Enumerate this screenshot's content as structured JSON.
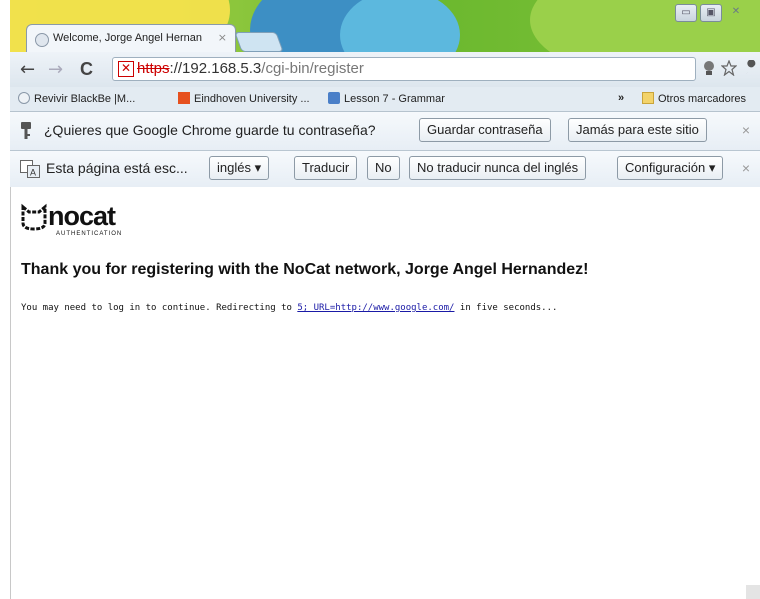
{
  "window": {
    "tab_title": "Welcome, Jorge Angel Hernan",
    "tab_close": "×",
    "minimize": "▭",
    "maximize": "▣",
    "close": "✕"
  },
  "toolbar": {
    "back": "←",
    "forward": "→",
    "reload": "C",
    "url_scheme": "https",
    "url_host": "://192.168.5.3",
    "url_path": "/cgi-bin/register",
    "ssl_error": "✕"
  },
  "bookmarks": {
    "items": [
      {
        "label": "Revivir BlackBe   |M...",
        "icon": "page-icon"
      },
      {
        "label": "Eindhoven University ...",
        "icon": "tue-icon"
      },
      {
        "label": "Lesson 7 - Grammar",
        "icon": "book-icon"
      }
    ],
    "overflow": "»",
    "other": "Otros marcadores"
  },
  "password_bar": {
    "text": "¿Quieres que Google Chrome guarde tu contraseña?",
    "save_label": "Guardar contraseña",
    "never_label": "Jamás para este sitio",
    "close": "×"
  },
  "translate_bar": {
    "text": "Esta página está esc...",
    "language": "inglés",
    "translate_label": "Traducir",
    "no_label": "No",
    "never_label": "No traducir nunca del inglés",
    "settings_label": "Configuración",
    "close": "×"
  },
  "page": {
    "logo_text": "nocat",
    "logo_sub": "AUTHENTICATION",
    "heading": "Thank you for registering with the NoCat network, Jorge Angel Hernandez!",
    "redirect_prefix": "You may need to log in to continue. Redirecting to ",
    "redirect_link": "5; URL=http://www.google.com/",
    "redirect_suffix": " in five seconds..."
  },
  "colors": {
    "accent_green": "#7fc23a",
    "link": "#1a1aa6",
    "ssl_error": "#cc0000"
  }
}
